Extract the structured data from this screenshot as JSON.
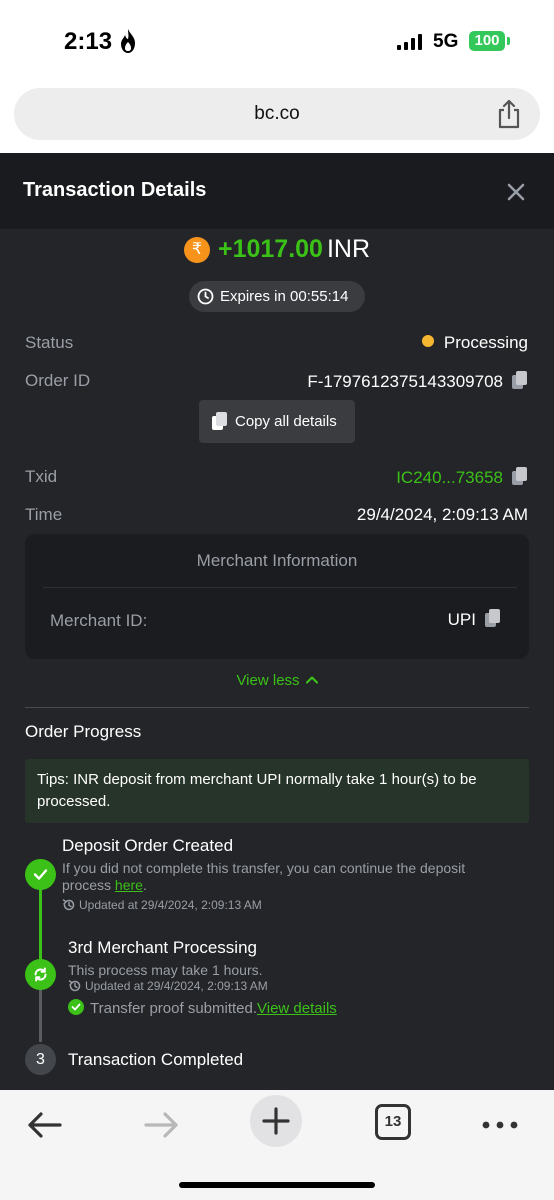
{
  "status_bar": {
    "time": "2:13",
    "network": "5G",
    "battery": "100"
  },
  "browser": {
    "url": "bc.co",
    "tab_count": "13"
  },
  "modal": {
    "title": "Transaction Details",
    "amount": "+1017.00",
    "currency": "INR",
    "expires": "Expires in 00:55:14",
    "rows": {
      "status_label": "Status",
      "status_value": "Processing",
      "order_label": "Order ID",
      "order_value": "F-1797612375143309708",
      "copy_all": "Copy all details",
      "txid_label": "Txid",
      "txid_value": "IC240...73658",
      "time_label": "Time",
      "time_value": "29/4/2024, 2:09:13 AM"
    },
    "merchant": {
      "title": "Merchant Information",
      "id_label": "Merchant ID:",
      "id_value": "UPI"
    },
    "view_less": "View less",
    "progress": {
      "title": "Order Progress",
      "tips": "Tips: INR deposit from merchant UPI normally take 1 hour(s) to be processed.",
      "steps": [
        {
          "title": "Deposit Order Created",
          "desc": "If you did not complete this transfer, you can continue the deposit process",
          "link": "here",
          "updated": "Updated at 29/4/2024, 2:09:13 AM"
        },
        {
          "title": "3rd Merchant Processing",
          "desc": "This process may take 1 hours.",
          "updated": "Updated at 29/4/2024, 2:09:13 AM",
          "proof": "Transfer proof submitted.",
          "proof_link": "View details"
        },
        {
          "number": "3",
          "title": "Transaction Completed"
        }
      ]
    }
  },
  "colors": {
    "accent_green": "#3bc117",
    "status_yellow": "#f5b731",
    "coin_orange": "#f7931a",
    "modal_bg": "#232528"
  },
  "icons": [
    "flame-icon",
    "signal-icon",
    "share-icon",
    "close-icon",
    "rupee-coin-icon",
    "clock-icon",
    "copy-icon",
    "chevron-up-icon",
    "check-icon",
    "sync-icon",
    "back-arrow-icon",
    "forward-arrow-icon",
    "plus-icon",
    "tabs-icon",
    "more-icon"
  ]
}
